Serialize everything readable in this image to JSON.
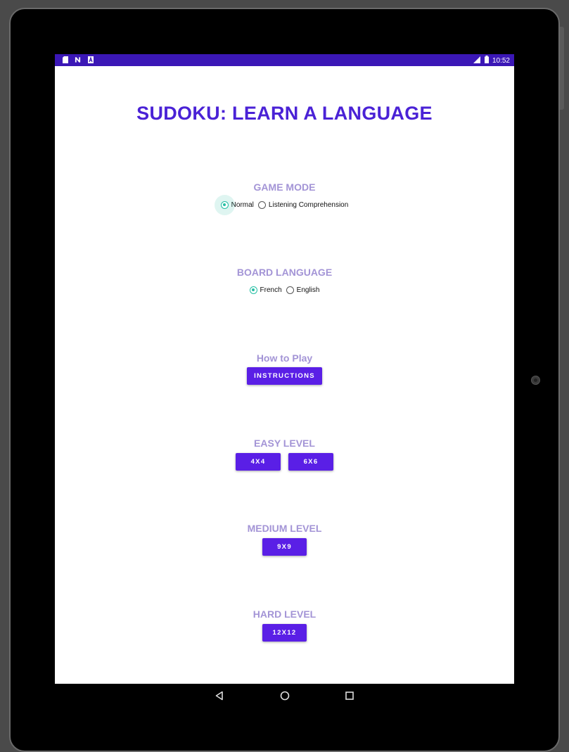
{
  "status_bar": {
    "time": "10:52",
    "left_icons": [
      "sd-card-icon",
      "n-icon",
      "a-icon"
    ],
    "right_icons": [
      "signal-icon",
      "battery-icon"
    ]
  },
  "app": {
    "title": "SUDOKU: LEARN A LANGUAGE",
    "game_mode": {
      "label": "GAME MODE",
      "options": [
        "Normal",
        "Listening Comprehension"
      ],
      "selected": "Normal"
    },
    "board_language": {
      "label": "BOARD LANGUAGE",
      "options": [
        "French",
        "English"
      ],
      "selected": "French"
    },
    "how_to_play": {
      "label": "How to Play",
      "button": "INSTRUCTIONS"
    },
    "easy": {
      "label": "EASY LEVEL",
      "buttons": [
        "4X4",
        "6X6"
      ]
    },
    "medium": {
      "label": "MEDIUM LEVEL",
      "buttons": [
        "9X9"
      ]
    },
    "hard": {
      "label": "HARD LEVEL",
      "buttons": [
        "12X12"
      ]
    }
  },
  "colors": {
    "accent": "#5a1fe6",
    "title": "#4a22d6",
    "section_label": "#a394d6",
    "radio_checked": "#26bfa4",
    "status_bar": "#3b17b6"
  },
  "nav_bar": {
    "icons": [
      "back-icon",
      "home-icon",
      "recents-icon"
    ]
  }
}
